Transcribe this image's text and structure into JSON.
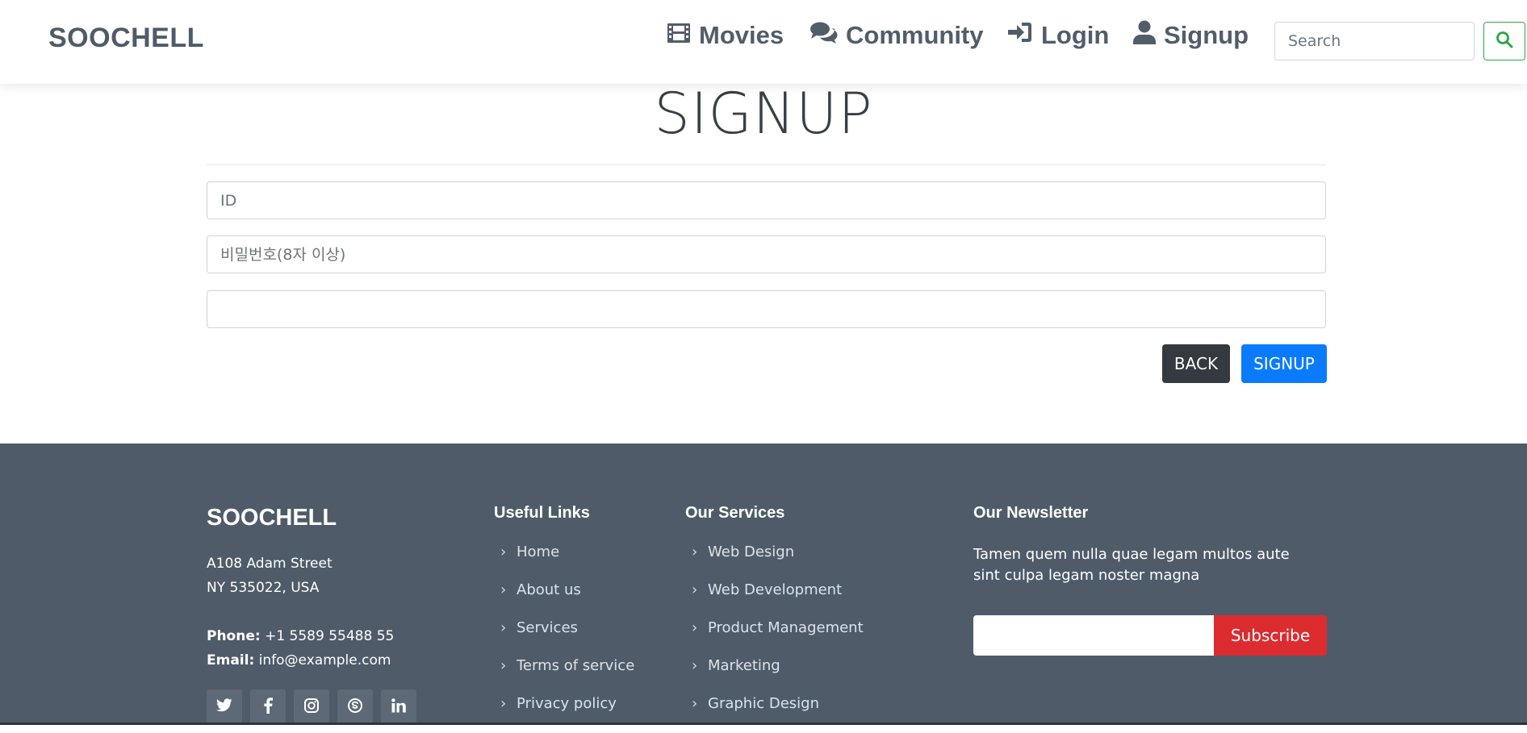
{
  "header": {
    "brand": "SOOCHELL",
    "nav": [
      {
        "label": "Movies",
        "icon": "film-icon"
      },
      {
        "label": "Community",
        "icon": "comments-icon"
      },
      {
        "label": "Login",
        "icon": "sign-in-icon"
      },
      {
        "label": "Signup",
        "icon": "user-icon"
      }
    ],
    "search": {
      "placeholder": "Search",
      "value": ""
    },
    "colors": {
      "brand_text": "#4f5b69",
      "search_button_border": "#28a745"
    }
  },
  "main": {
    "title": "SIGNUP",
    "fields": [
      {
        "placeholder": "ID",
        "value": ""
      },
      {
        "placeholder": "비밀번호(8자 이상)",
        "value": ""
      },
      {
        "placeholder": "",
        "value": ""
      }
    ],
    "buttons": {
      "back": "BACK",
      "signup": "SIGNUP"
    },
    "colors": {
      "back": "#343a40",
      "signup": "#0a7bff"
    }
  },
  "footer": {
    "brand": "SOOCHELL",
    "address_line1": "A108 Adam Street",
    "address_line2": "NY 535022, USA",
    "phone_label": "Phone:",
    "phone": "+1 5589 55488 55",
    "email_label": "Email:",
    "email": "info@example.com",
    "socials": [
      "twitter-icon",
      "facebook-icon",
      "instagram-icon",
      "skype-icon",
      "linkedin-icon"
    ],
    "useful_links": {
      "title": "Useful Links",
      "items": [
        "Home",
        "About us",
        "Services",
        "Terms of service",
        "Privacy policy"
      ]
    },
    "services": {
      "title": "Our Services",
      "items": [
        "Web Design",
        "Web Development",
        "Product Management",
        "Marketing",
        "Graphic Design"
      ]
    },
    "newsletter": {
      "title": "Our Newsletter",
      "text": "Tamen quem nulla quae legam multos aute sint culpa legam noster magna",
      "button": "Subscribe"
    },
    "colors": {
      "background": "#505b69",
      "subscribe": "#dc2c30"
    }
  }
}
